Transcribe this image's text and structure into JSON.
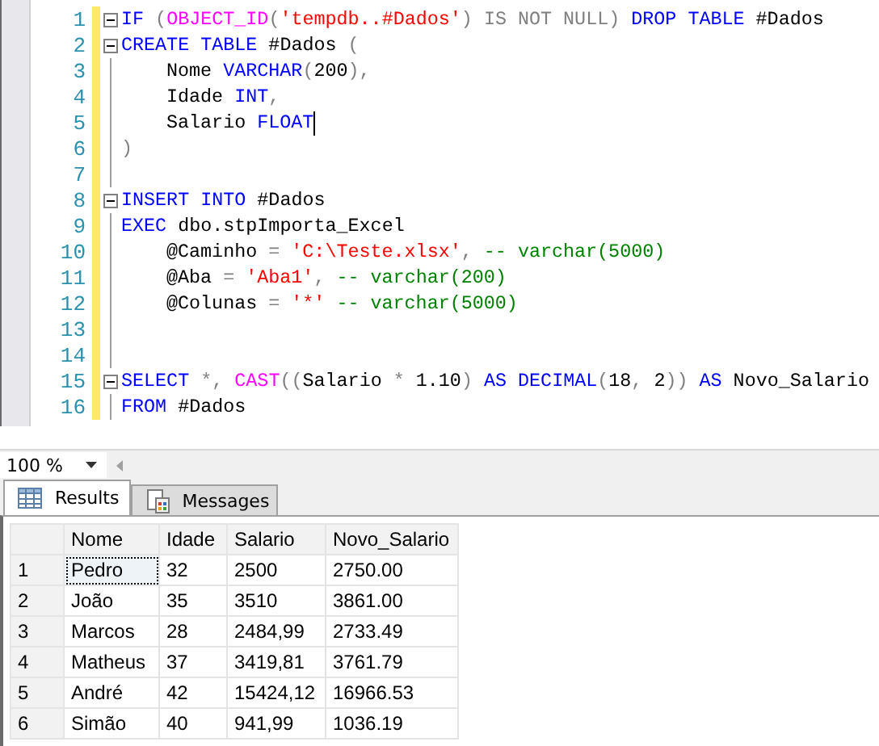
{
  "editor": {
    "lines": [
      {
        "number": "1",
        "fold": true,
        "indent": false,
        "caret": false,
        "tokens": [
          {
            "kind": "keyword",
            "text": "IF "
          },
          {
            "kind": "operator",
            "text": "("
          },
          {
            "kind": "function",
            "text": "OBJECT_ID"
          },
          {
            "kind": "operator",
            "text": "("
          },
          {
            "kind": "string",
            "text": "'tempdb..#Dados'"
          },
          {
            "kind": "operator",
            "text": ") IS NOT NULL)"
          },
          {
            "kind": "keyword",
            "text": " DROP TABLE"
          },
          {
            "kind": "plain",
            "text": " #Dados"
          }
        ]
      },
      {
        "number": "2",
        "fold": true,
        "indent": false,
        "caret": false,
        "tokens": [
          {
            "kind": "keyword",
            "text": "CREATE TABLE"
          },
          {
            "kind": "plain",
            "text": " #Dados "
          },
          {
            "kind": "operator",
            "text": "("
          }
        ]
      },
      {
        "number": "3",
        "fold": false,
        "indent": true,
        "caret": false,
        "tokens": [
          {
            "kind": "plain",
            "text": "Nome "
          },
          {
            "kind": "keyword",
            "text": "VARCHAR"
          },
          {
            "kind": "operator",
            "text": "("
          },
          {
            "kind": "plain",
            "text": "200"
          },
          {
            "kind": "operator",
            "text": "),"
          }
        ]
      },
      {
        "number": "4",
        "fold": false,
        "indent": true,
        "caret": false,
        "tokens": [
          {
            "kind": "plain",
            "text": "Idade "
          },
          {
            "kind": "keyword",
            "text": "INT"
          },
          {
            "kind": "operator",
            "text": ","
          }
        ]
      },
      {
        "number": "5",
        "fold": false,
        "indent": true,
        "caret": true,
        "tokens": [
          {
            "kind": "plain",
            "text": "Salario "
          },
          {
            "kind": "keyword",
            "text": "FLOAT"
          }
        ]
      },
      {
        "number": "6",
        "fold": false,
        "indent": false,
        "caret": false,
        "tokens": [
          {
            "kind": "operator",
            "text": ")"
          }
        ]
      },
      {
        "number": "7",
        "fold": false,
        "caret": false
      },
      {
        "number": "8",
        "fold": true,
        "indent": false,
        "caret": false,
        "tokens": [
          {
            "kind": "keyword",
            "text": "INSERT INTO"
          },
          {
            "kind": "plain",
            "text": " #Dados"
          }
        ]
      },
      {
        "number": "9",
        "fold": false,
        "indent": false,
        "caret": false,
        "tokens": [
          {
            "kind": "keyword",
            "text": "EXEC"
          },
          {
            "kind": "plain",
            "text": " dbo.stpImporta_Excel"
          }
        ]
      },
      {
        "number": "10",
        "fold": false,
        "indent": true,
        "caret": false,
        "tokens": [
          {
            "kind": "plain",
            "text": "@Caminho "
          },
          {
            "kind": "operator",
            "text": "= "
          },
          {
            "kind": "string",
            "text": "'C:\\Teste.xlsx'"
          },
          {
            "kind": "operator",
            "text": ","
          },
          {
            "kind": "comment",
            "text": " -- varchar(5000)"
          }
        ]
      },
      {
        "number": "11",
        "fold": false,
        "indent": true,
        "caret": false,
        "tokens": [
          {
            "kind": "plain",
            "text": "@Aba "
          },
          {
            "kind": "operator",
            "text": "= "
          },
          {
            "kind": "string",
            "text": "'Aba1'"
          },
          {
            "kind": "operator",
            "text": ","
          },
          {
            "kind": "comment",
            "text": " -- varchar(200)"
          }
        ]
      },
      {
        "number": "12",
        "fold": false,
        "indent": true,
        "caret": false,
        "tokens": [
          {
            "kind": "plain",
            "text": "@Colunas "
          },
          {
            "kind": "operator",
            "text": "= "
          },
          {
            "kind": "string",
            "text": "'*'"
          },
          {
            "kind": "comment",
            "text": " -- varchar(5000)"
          }
        ]
      },
      {
        "number": "13",
        "fold": false,
        "caret": false
      },
      {
        "number": "14",
        "fold": false,
        "caret": false
      },
      {
        "number": "15",
        "fold": true,
        "indent": false,
        "caret": false,
        "tokens": [
          {
            "kind": "keyword",
            "text": "SELECT "
          },
          {
            "kind": "operator",
            "text": "*,"
          },
          {
            "kind": "function",
            "text": " CAST"
          },
          {
            "kind": "operator",
            "text": "(("
          },
          {
            "kind": "plain",
            "text": "Salario "
          },
          {
            "kind": "operator",
            "text": "* "
          },
          {
            "kind": "plain",
            "text": "1.10"
          },
          {
            "kind": "operator",
            "text": ")"
          },
          {
            "kind": "keyword",
            "text": " AS DECIMAL"
          },
          {
            "kind": "operator",
            "text": "("
          },
          {
            "kind": "plain",
            "text": "18"
          },
          {
            "kind": "operator",
            "text": ", "
          },
          {
            "kind": "plain",
            "text": "2"
          },
          {
            "kind": "operator",
            "text": "))"
          },
          {
            "kind": "keyword",
            "text": " AS"
          },
          {
            "kind": "plain",
            "text": " Novo_Salario"
          }
        ]
      },
      {
        "number": "16",
        "fold": false,
        "indent": false,
        "caret": false,
        "tokens": [
          {
            "kind": "keyword",
            "text": "FROM"
          },
          {
            "kind": "plain",
            "text": " #Dados"
          }
        ]
      }
    ]
  },
  "zoom": "100 %",
  "tabs": [
    {
      "label": "Results",
      "selected": true
    },
    {
      "label": "Messages",
      "selected": false
    }
  ],
  "grid": {
    "columns": [
      "Nome",
      "Idade",
      "Salario",
      "Novo_Salario"
    ],
    "rows": [
      {
        "number": "1",
        "focused": true,
        "cells": [
          "Pedro",
          "32",
          "2500",
          "2750.00"
        ]
      },
      {
        "number": "2",
        "focused": false,
        "cells": [
          "João",
          "35",
          "3510",
          "3861.00"
        ]
      },
      {
        "number": "3",
        "focused": false,
        "cells": [
          "Marcos",
          "28",
          "2484,99",
          "2733.49"
        ]
      },
      {
        "number": "4",
        "focused": false,
        "cells": [
          "Matheus",
          "37",
          "3419,81",
          "3761.79"
        ]
      },
      {
        "number": "5",
        "focused": false,
        "cells": [
          "André",
          "42",
          "15424,12",
          "16966.53"
        ]
      },
      {
        "number": "6",
        "focused": false,
        "cells": [
          "Simão",
          "40",
          "941,99",
          "1036.19"
        ]
      }
    ]
  }
}
